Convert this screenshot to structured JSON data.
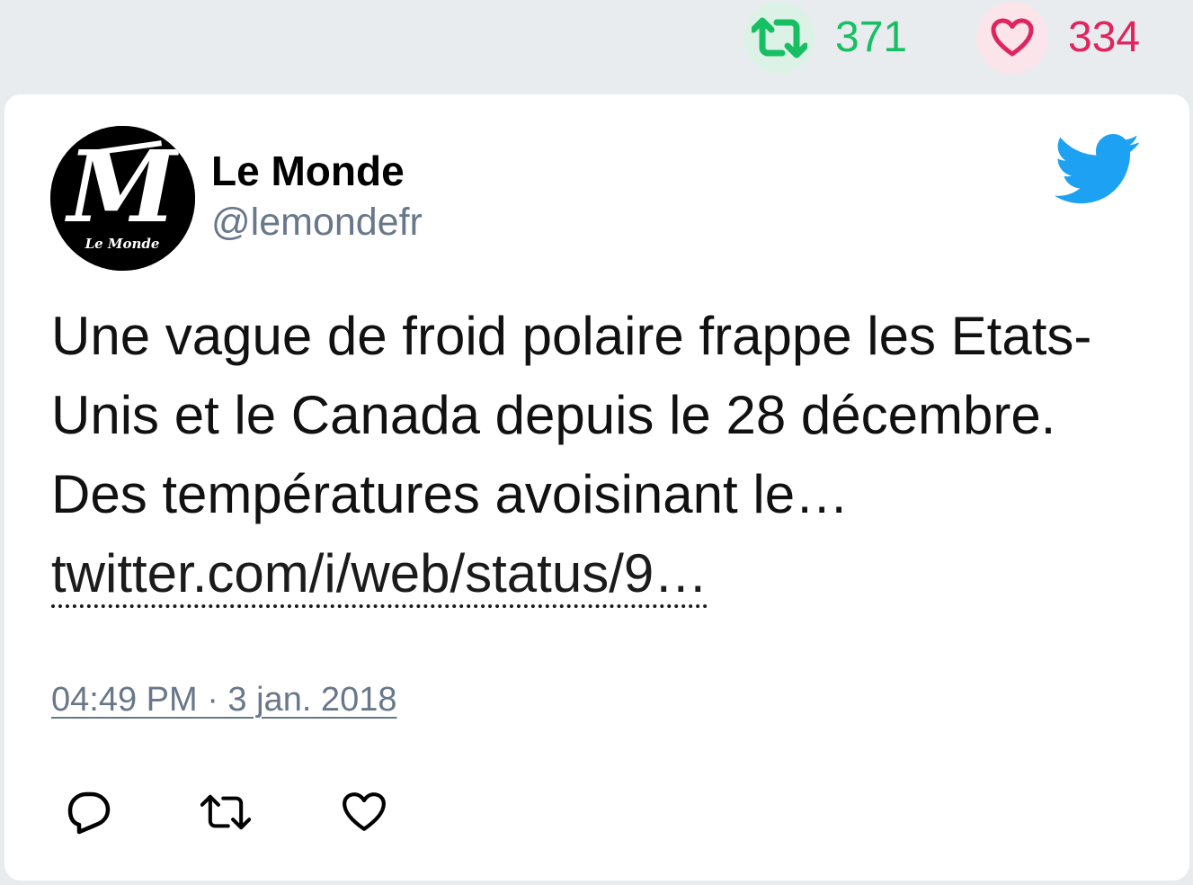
{
  "stats": {
    "retweet_count": "371",
    "like_count": "334"
  },
  "tweet": {
    "author_name": "Le Monde",
    "author_handle": "@lemondefr",
    "avatar_text": "Le Monde",
    "text_prefix": "Une vague de froid polaire frappe les Etats-Unis et le Canada depuis le 28 décembre. Des températures avoisinant le… ",
    "link_text": "twitter.com/i/web/status/9…",
    "timestamp": "04:49 PM · 3 jan. 2018"
  },
  "icons": {
    "retweet_stat": "retweet-icon",
    "like_stat": "heart-icon",
    "brand": "twitter-bird-icon",
    "reply_action": "reply-icon",
    "retweet_action": "retweet-icon",
    "like_action": "heart-icon"
  },
  "colors": {
    "retweet_green": "#17bf63",
    "like_red": "#e0245e",
    "twitter_blue": "#1da1f2",
    "muted_text": "#68788a",
    "page_background": "#e9ecee"
  }
}
